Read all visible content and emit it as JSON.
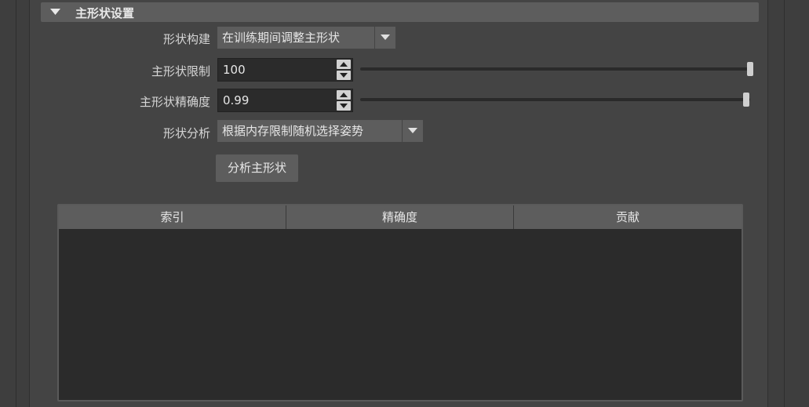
{
  "section": {
    "title": "主形状设置"
  },
  "shape_build": {
    "label": "形状构建",
    "value": "在训练期间调整主形状"
  },
  "shape_limit": {
    "label": "主形状限制",
    "value": "100",
    "slider_fraction": 1.0
  },
  "shape_precision": {
    "label": "主形状精确度",
    "value": "0.99",
    "slider_fraction": 0.99
  },
  "shape_analysis": {
    "label": "形状分析",
    "value": "根据内存限制随机选择姿势"
  },
  "analyze_button": {
    "label": "分析主形状"
  },
  "table": {
    "columns": [
      "索引",
      "精确度",
      "贡献"
    ],
    "rows": []
  },
  "colors": {
    "background": "#444444",
    "header": "#5d5d5d",
    "field": "#2b2b2b"
  }
}
